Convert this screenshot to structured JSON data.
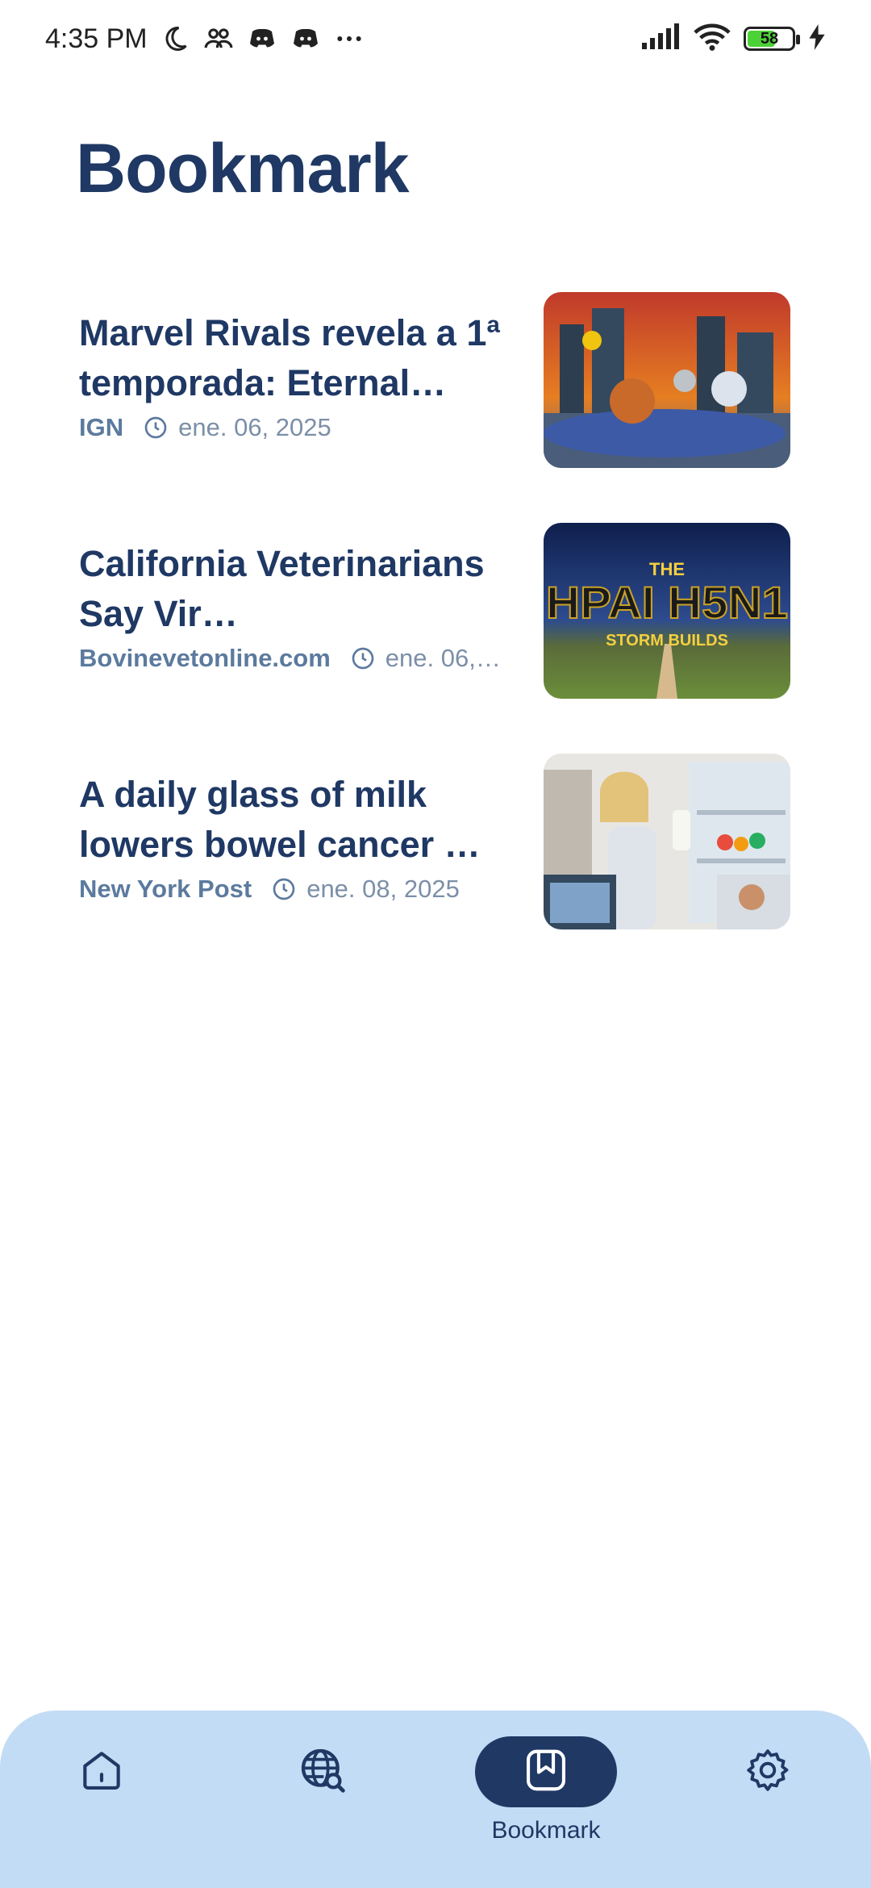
{
  "status_bar": {
    "time": "4:35 PM",
    "battery": "58",
    "icons": [
      "moon-icon",
      "people-icon",
      "discord-icon",
      "discord-icon",
      "more-dots-icon",
      "signal-icon",
      "wifi-icon",
      "battery-icon",
      "charging-icon"
    ]
  },
  "page": {
    "title": "Bookmark"
  },
  "bookmarks": [
    {
      "title": "Marvel Rivals revela a 1ª temporada: Eternal…",
      "source": "IGN",
      "date": "ene. 06, 2025",
      "image": "marvel-rivals-thumbnail"
    },
    {
      "title": "California Veterinarians Say Vir…",
      "source": "Bovinevetonline.com",
      "date": "ene. 06, …",
      "image": "hpai-h5n1-storm-thumbnail",
      "image_text": {
        "top": "THE",
        "main": "HPAI H5N1",
        "bottom": "STORM BUILDS"
      }
    },
    {
      "title": "A daily glass of milk lowers bowel cancer …",
      "source": "New York Post",
      "date": "ene. 08, 2025",
      "image": "milk-fridge-thumbnail"
    }
  ],
  "nav": {
    "items": [
      {
        "name": "home",
        "icon": "home-icon"
      },
      {
        "name": "explore",
        "icon": "globe-search-icon"
      },
      {
        "name": "bookmark",
        "icon": "bookmark-icon",
        "label": "Bookmark",
        "active": true
      },
      {
        "name": "settings",
        "icon": "gear-icon"
      }
    ]
  },
  "colors": {
    "primary": "#1f3864",
    "nav_bg": "#c3dcf5",
    "source": "#5c7a9e",
    "date": "#7c8fa8"
  }
}
